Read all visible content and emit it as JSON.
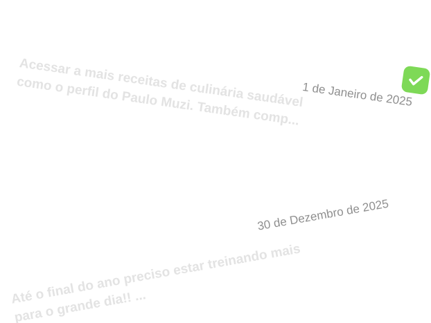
{
  "goals": [
    {
      "description": "Acessar a mais receitas de culinária saudável como o perfil do Paulo Muzi. Também comp...",
      "date": "1 de Janeiro de 2025",
      "completed": true,
      "accent_color": "#7ed957"
    },
    {
      "description": "Até o final do ano preciso estar treinando mais para o grande dia!! ...",
      "date": "30 de Dezembro de 2025",
      "completed": false
    }
  ],
  "icons": {
    "check": "check-icon"
  }
}
